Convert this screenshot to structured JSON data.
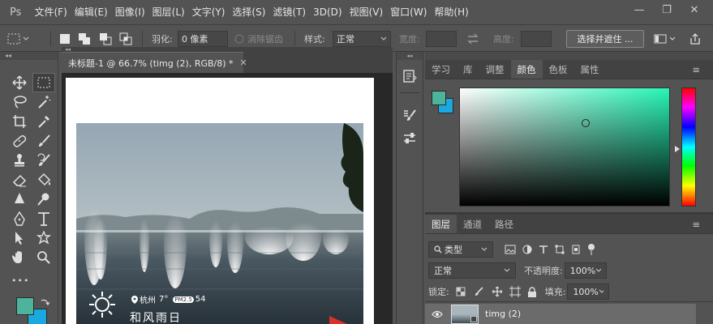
{
  "app": {
    "logo_text": "Ps"
  },
  "menu": [
    "文件(F)",
    "编辑(E)",
    "图像(I)",
    "图层(L)",
    "文字(Y)",
    "选择(S)",
    "滤镜(T)",
    "3D(D)",
    "视图(V)",
    "窗口(W)",
    "帮助(H)"
  ],
  "window_controls": {
    "minimize": "—",
    "restore": "❐",
    "close": "✕"
  },
  "options_bar": {
    "feather_label": "羽化:",
    "feather_value": "0 像素",
    "antialias_label": "消除锯齿",
    "style_label": "样式:",
    "style_value": "正常",
    "width_label": "宽度:",
    "height_label": "高度:",
    "select_mask_button": "选择并遮住 ..."
  },
  "document": {
    "tab_title": "未标题-1 @ 66.7% (timg (2), RGB/8) *",
    "close_glyph": "✕",
    "overlay": {
      "location": "杭州",
      "temp": "7°",
      "pm_badge": "PM2.5",
      "pm_value": "54",
      "weather": "和风雨日"
    }
  },
  "top_panel": {
    "tabs": [
      "学习",
      "库",
      "调整",
      "颜色",
      "色板",
      "属性"
    ],
    "active_tab": "颜色",
    "colors": {
      "foreground": "#4db39a",
      "background": "#1aa8e0",
      "picker_hue": "#27f5b6"
    }
  },
  "layers_panel": {
    "tabs": [
      "图层",
      "通道",
      "路径"
    ],
    "active_tab": "图层",
    "filter_label": "类型",
    "blend_mode": "正常",
    "opacity_label": "不透明度:",
    "opacity_value": "100%",
    "lock_label": "锁定:",
    "fill_label": "填充:",
    "fill_value": "100%",
    "layers": [
      {
        "name": "timg (2)"
      }
    ]
  },
  "toolbar_colors": {
    "foreground": "#4db39a",
    "background": "#1aa8e0"
  },
  "toolbar_more": "•••"
}
